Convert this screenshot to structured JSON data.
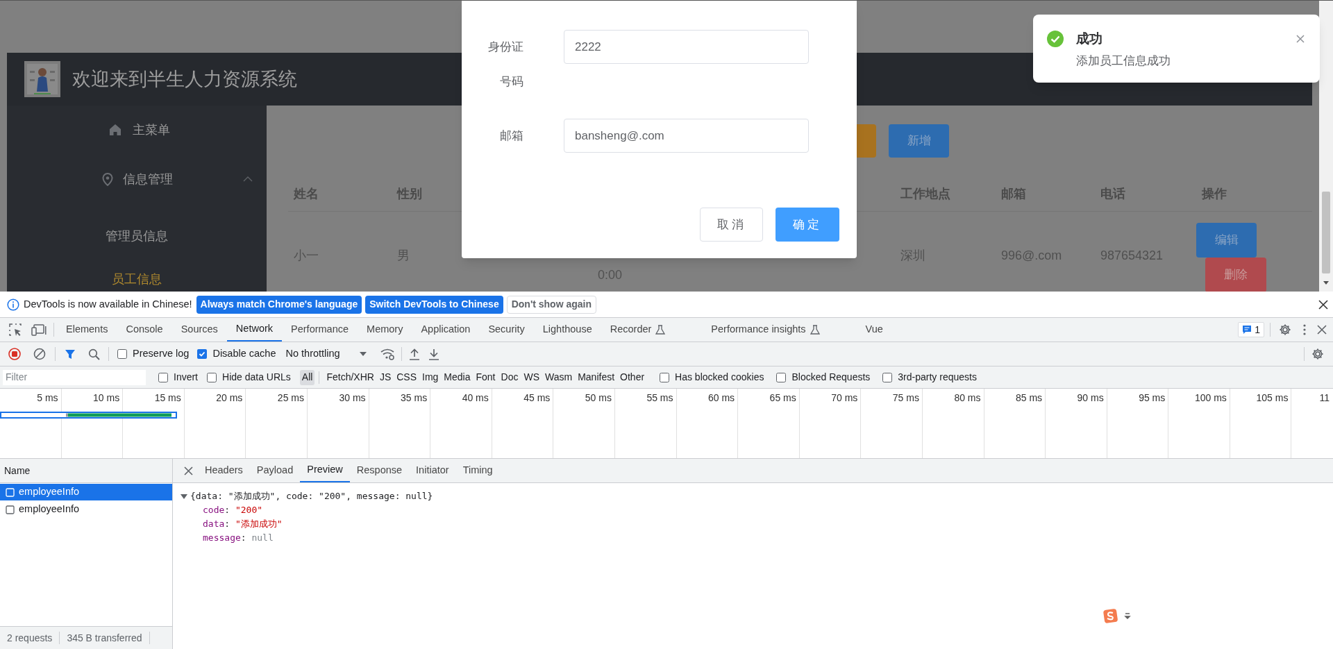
{
  "app": {
    "title": "欢迎来到半生人力资源系统",
    "sidebar": [
      {
        "kind": "link",
        "label": "主菜单"
      },
      {
        "kind": "group",
        "label": "信息管理",
        "expanded": true,
        "children": [
          {
            "label": "管理员信息",
            "selected": false
          },
          {
            "label": "员工信息",
            "selected": true
          }
        ]
      }
    ],
    "actions": [
      {
        "label": "新增"
      }
    ],
    "table": {
      "columns": [
        "姓名",
        "性别",
        "",
        "",
        "",
        "",
        "工作地点",
        "邮箱",
        "电话",
        "操作"
      ],
      "rows": [
        {
          "cells": [
            "小一",
            "男",
            "",
            "0:00",
            "",
            "",
            "深圳",
            "996@.com",
            "987654321"
          ],
          "actions": [
            {
              "label": "编辑",
              "kind": "edit"
            },
            {
              "label": "删除",
              "kind": "delete"
            }
          ]
        }
      ]
    }
  },
  "dialog": {
    "fields": [
      {
        "label": "身份证号码",
        "value": "2222"
      },
      {
        "label": "邮箱",
        "value": "bansheng@.com"
      }
    ],
    "buttons": [
      {
        "label": "取消",
        "kind": "cancel"
      },
      {
        "label": "确定",
        "kind": "primary"
      }
    ]
  },
  "notification": {
    "kind": "success",
    "title": "成功",
    "message": "添加员工信息成功"
  },
  "devtools": {
    "infobar": {
      "message": "DevTools is now available in Chinese!",
      "buttons": [
        {
          "label": "Always match Chrome's language",
          "kind": "primary"
        },
        {
          "label": "Switch DevTools to Chinese",
          "kind": "primary"
        },
        {
          "label": "Don't show again",
          "kind": "secondary"
        }
      ]
    },
    "tabs": [
      {
        "label": "Elements",
        "selected": false,
        "experimental": false
      },
      {
        "label": "Console",
        "selected": false,
        "experimental": false
      },
      {
        "label": "Sources",
        "selected": false,
        "experimental": false
      },
      {
        "label": "Network",
        "selected": true,
        "experimental": false
      },
      {
        "label": "Performance",
        "selected": false,
        "experimental": false
      },
      {
        "label": "Memory",
        "selected": false,
        "experimental": false
      },
      {
        "label": "Application",
        "selected": false,
        "experimental": false
      },
      {
        "label": "Security",
        "selected": false,
        "experimental": false
      },
      {
        "label": "Lighthouse",
        "selected": false,
        "experimental": false
      },
      {
        "label": "Recorder",
        "selected": false,
        "experimental": true
      },
      {
        "label": "Performance insights",
        "selected": false,
        "experimental": true
      },
      {
        "label": "Vue",
        "selected": false,
        "experimental": false
      }
    ],
    "issues_count": "1",
    "toolbar": {
      "checkboxes": [
        {
          "label": "Preserve log",
          "checked": false
        },
        {
          "label": "Disable cache",
          "checked": true
        }
      ],
      "throttling": "No throttling"
    },
    "filter": {
      "placeholder": "Filter",
      "options": [
        {
          "label": "Invert",
          "checked": false
        },
        {
          "label": "Hide data URLs",
          "checked": false
        }
      ],
      "types": [
        {
          "label": "All",
          "selected": true
        },
        {
          "label": "Fetch/XHR",
          "selected": false
        },
        {
          "label": "JS",
          "selected": false
        },
        {
          "label": "CSS",
          "selected": false
        },
        {
          "label": "Img",
          "selected": false
        },
        {
          "label": "Media",
          "selected": false
        },
        {
          "label": "Font",
          "selected": false
        },
        {
          "label": "Doc",
          "selected": false
        },
        {
          "label": "WS",
          "selected": false
        },
        {
          "label": "Wasm",
          "selected": false
        },
        {
          "label": "Manifest",
          "selected": false
        },
        {
          "label": "Other",
          "selected": false
        }
      ],
      "extra_options": [
        {
          "label": "Has blocked cookies",
          "checked": false
        },
        {
          "label": "Blocked Requests",
          "checked": false
        },
        {
          "label": "3rd-party requests",
          "checked": false
        }
      ]
    },
    "timeline": {
      "ticks": [
        "5 ms",
        "10 ms",
        "15 ms",
        "20 ms",
        "25 ms",
        "30 ms",
        "35 ms",
        "40 ms",
        "45 ms",
        "50 ms",
        "55 ms",
        "60 ms",
        "65 ms",
        "70 ms",
        "75 ms",
        "80 ms",
        "85 ms",
        "90 ms",
        "95 ms",
        "100 ms",
        "105 ms",
        "11"
      ]
    },
    "requests": {
      "header": "Name",
      "items": [
        {
          "name": "employeeInfo",
          "selected": true
        },
        {
          "name": "employeeInfo",
          "selected": false
        }
      ]
    },
    "status_bar": [
      "2 requests",
      "345 B transferred"
    ],
    "detail": {
      "tabs": [
        {
          "label": "Headers",
          "selected": false
        },
        {
          "label": "Payload",
          "selected": false
        },
        {
          "label": "Preview",
          "selected": true
        },
        {
          "label": "Response",
          "selected": false
        },
        {
          "label": "Initiator",
          "selected": false
        },
        {
          "label": "Timing",
          "selected": false
        }
      ],
      "preview": {
        "expanded": true,
        "summary": "{data: \"添加成功\", code: \"200\", message: null}",
        "separator": ":",
        "properties": [
          {
            "key": "code",
            "value": "\"200\"",
            "kind": "string"
          },
          {
            "key": "data",
            "value": "\"添加成功\"",
            "kind": "string"
          },
          {
            "key": "message",
            "value": "null",
            "kind": "null"
          }
        ]
      }
    }
  }
}
